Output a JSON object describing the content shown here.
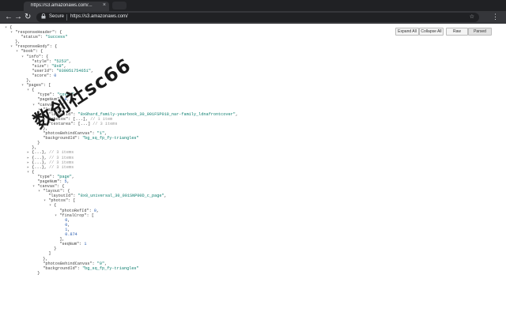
{
  "browser": {
    "tab_title": "https://s3.amazonaws.com/...",
    "tab_close": "×",
    "security_label": "Secure",
    "url": "https://s3.amazonaws.com/",
    "back": "←",
    "forward": "→",
    "reload": "↻",
    "star": "☆",
    "menu": "⋮",
    "lock": "🔒"
  },
  "viewer_toolbar": {
    "expand_all": "Expand All",
    "collapse_all": "Collapse All",
    "raw": "Raw",
    "parsed": "Parsed"
  },
  "json_lines": [
    {
      "i": 0,
      "t": "▾",
      "parts": [
        [
          "p",
          "{"
        ]
      ]
    },
    {
      "i": 1,
      "t": "▾",
      "parts": [
        [
          "k",
          "\"responseHeader\""
        ],
        [
          "p",
          ": {"
        ]
      ]
    },
    {
      "i": 2,
      "t": "",
      "parts": [
        [
          "k",
          "\"status\""
        ],
        [
          "p",
          ": "
        ],
        [
          "s",
          "\"Success\""
        ]
      ]
    },
    {
      "i": 1,
      "t": "",
      "parts": [
        [
          "p",
          "},"
        ]
      ]
    },
    {
      "i": 1,
      "t": "▾",
      "parts": [
        [
          "k",
          "\"responseBody\""
        ],
        [
          "p",
          ": {"
        ]
      ]
    },
    {
      "i": 2,
      "t": "▾",
      "parts": [
        [
          "k",
          "\"book\""
        ],
        [
          "p",
          ": {"
        ]
      ]
    },
    {
      "i": 3,
      "t": "▾",
      "parts": [
        [
          "k",
          "\"info\""
        ],
        [
          "p",
          ": {"
        ]
      ]
    },
    {
      "i": 4,
      "t": "",
      "parts": [
        [
          "k",
          "\"style\""
        ],
        [
          "p",
          ": "
        ],
        [
          "s",
          "\"5253\""
        ],
        [
          "p",
          ","
        ]
      ]
    },
    {
      "i": 4,
      "t": "",
      "parts": [
        [
          "k",
          "\"size\""
        ],
        [
          "p",
          ": "
        ],
        [
          "s",
          "\"8x8\""
        ],
        [
          "p",
          ","
        ]
      ]
    },
    {
      "i": 4,
      "t": "",
      "parts": [
        [
          "k",
          "\"userId\""
        ],
        [
          "p",
          ": "
        ],
        [
          "s",
          "\"039051754651\""
        ],
        [
          "p",
          ","
        ]
      ]
    },
    {
      "i": 4,
      "t": "",
      "parts": [
        [
          "k",
          "\"score\""
        ],
        [
          "p",
          ": "
        ],
        [
          "n",
          "0"
        ]
      ]
    },
    {
      "i": 3,
      "t": "",
      "parts": [
        [
          "p",
          "},"
        ]
      ]
    },
    {
      "i": 3,
      "t": "▾",
      "parts": [
        [
          "k",
          "\"pages\""
        ],
        [
          "p",
          ": ["
        ]
      ]
    },
    {
      "i": 4,
      "t": "▾",
      "parts": [
        [
          "p",
          "{"
        ]
      ]
    },
    {
      "i": 5,
      "t": "",
      "parts": [
        [
          "k",
          "\"type\""
        ],
        [
          "p",
          ": "
        ],
        [
          "s",
          "\"cover\""
        ],
        [
          "p",
          ","
        ]
      ]
    },
    {
      "i": 5,
      "t": "",
      "parts": [
        [
          "k",
          "\"pageNum\""
        ],
        [
          "p",
          ": "
        ],
        [
          "n",
          "0"
        ],
        [
          "p",
          ","
        ]
      ]
    },
    {
      "i": 5,
      "t": "▾",
      "parts": [
        [
          "k",
          "\"canvas\""
        ],
        [
          "p",
          ": {"
        ]
      ]
    },
    {
      "i": 6,
      "t": "▾",
      "parts": [
        [
          "k",
          "\"layout\""
        ],
        [
          "p",
          ": {"
        ]
      ]
    },
    {
      "i": 7,
      "t": "",
      "parts": [
        [
          "k",
          "\"layoutId\""
        ],
        [
          "p",
          ": "
        ],
        [
          "s",
          "\"8x8hard_family-yearbook_30_001FSP010_nar-family_ldnafrontcover\""
        ],
        [
          "p",
          ","
        ]
      ]
    },
    {
      "i": 7,
      "t": "▸",
      "parts": [
        [
          "k",
          "\"photos\""
        ],
        [
          "p",
          ": [...], "
        ],
        [
          "c",
          "// 1 item"
        ]
      ]
    },
    {
      "i": 7,
      "t": "▸",
      "parts": [
        [
          "k",
          "\"textarea\""
        ],
        [
          "p",
          ": [...] "
        ],
        [
          "c",
          "// 3 items"
        ]
      ]
    },
    {
      "i": 6,
      "t": "",
      "parts": [
        [
          "p",
          "},"
        ]
      ]
    },
    {
      "i": 6,
      "t": "",
      "parts": [
        [
          "k",
          "\"photosBehindCanvas\""
        ],
        [
          "p",
          ": "
        ],
        [
          "s",
          "\"1\""
        ],
        [
          "p",
          ","
        ]
      ]
    },
    {
      "i": 6,
      "t": "",
      "parts": [
        [
          "k",
          "\"backgroundId\""
        ],
        [
          "p",
          ": "
        ],
        [
          "s",
          "\"bg_sq_fp_fy-triangles\""
        ]
      ]
    },
    {
      "i": 5,
      "t": "",
      "parts": [
        [
          "p",
          "}"
        ]
      ]
    },
    {
      "i": 4,
      "t": "",
      "parts": [
        [
          "p",
          "},"
        ]
      ]
    },
    {
      "i": 4,
      "t": "▸",
      "parts": [
        [
          "p",
          "{...}, "
        ],
        [
          "c",
          "// 3 items"
        ]
      ]
    },
    {
      "i": 4,
      "t": "▸",
      "parts": [
        [
          "p",
          "{...}, "
        ],
        [
          "c",
          "// 3 items"
        ]
      ]
    },
    {
      "i": 4,
      "t": "▸",
      "parts": [
        [
          "p",
          "{...}, "
        ],
        [
          "c",
          "// 3 items"
        ]
      ]
    },
    {
      "i": 4,
      "t": "▸",
      "parts": [
        [
          "p",
          "{...}, "
        ],
        [
          "c",
          "// 3 items"
        ]
      ]
    },
    {
      "i": 4,
      "t": "▾",
      "parts": [
        [
          "p",
          "{"
        ]
      ]
    },
    {
      "i": 5,
      "t": "",
      "parts": [
        [
          "k",
          "\"type\""
        ],
        [
          "p",
          ": "
        ],
        [
          "s",
          "\"page\""
        ],
        [
          "p",
          ","
        ]
      ]
    },
    {
      "i": 5,
      "t": "",
      "parts": [
        [
          "k",
          "\"pageNum\""
        ],
        [
          "p",
          ": "
        ],
        [
          "n",
          "5"
        ],
        [
          "p",
          ","
        ]
      ]
    },
    {
      "i": 5,
      "t": "▾",
      "parts": [
        [
          "k",
          "\"canvas\""
        ],
        [
          "p",
          ": {"
        ]
      ]
    },
    {
      "i": 6,
      "t": "▾",
      "parts": [
        [
          "k",
          "\"layout\""
        ],
        [
          "p",
          ": {"
        ]
      ]
    },
    {
      "i": 7,
      "t": "",
      "parts": [
        [
          "k",
          "\"layoutId\""
        ],
        [
          "p",
          ": "
        ],
        [
          "s",
          "\"8x8_universal_30_001SNP00D_c_page\""
        ],
        [
          "p",
          ","
        ]
      ]
    },
    {
      "i": 7,
      "t": "▾",
      "parts": [
        [
          "k",
          "\"photos\""
        ],
        [
          "p",
          ": ["
        ]
      ]
    },
    {
      "i": 8,
      "t": "▾",
      "parts": [
        [
          "p",
          "{"
        ]
      ]
    },
    {
      "i": 9,
      "t": "",
      "parts": [
        [
          "k",
          "\"photoRefId\""
        ],
        [
          "p",
          ": "
        ],
        [
          "n",
          "0"
        ],
        [
          "p",
          ","
        ]
      ]
    },
    {
      "i": 9,
      "t": "▾",
      "parts": [
        [
          "k",
          "\"finalCrop\""
        ],
        [
          "p",
          ": ["
        ]
      ]
    },
    {
      "i": 10,
      "t": "",
      "parts": [
        [
          "n",
          "0"
        ],
        [
          "p",
          ","
        ]
      ]
    },
    {
      "i": 10,
      "t": "",
      "parts": [
        [
          "n",
          "0"
        ],
        [
          "p",
          ","
        ]
      ]
    },
    {
      "i": 10,
      "t": "",
      "parts": [
        [
          "n",
          "1"
        ],
        [
          "p",
          ","
        ]
      ]
    },
    {
      "i": 10,
      "t": "",
      "parts": [
        [
          "n",
          "0.874"
        ]
      ]
    },
    {
      "i": 9,
      "t": "",
      "parts": [
        [
          "p",
          "],"
        ]
      ]
    },
    {
      "i": 9,
      "t": "",
      "parts": [
        [
          "k",
          "\"seqNum\""
        ],
        [
          "p",
          ": "
        ],
        [
          "n",
          "1"
        ]
      ]
    },
    {
      "i": 8,
      "t": "",
      "parts": [
        [
          "p",
          "}"
        ]
      ]
    },
    {
      "i": 7,
      "t": "",
      "parts": [
        [
          "p",
          "]"
        ]
      ]
    },
    {
      "i": 6,
      "t": "",
      "parts": [
        [
          "p",
          "},"
        ]
      ]
    },
    {
      "i": 6,
      "t": "",
      "parts": [
        [
          "k",
          "\"photosBehindCanvas\""
        ],
        [
          "p",
          ": "
        ],
        [
          "s",
          "\"0\""
        ],
        [
          "p",
          ","
        ]
      ]
    },
    {
      "i": 6,
      "t": "",
      "parts": [
        [
          "k",
          "\"backgroundId\""
        ],
        [
          "p",
          ": "
        ],
        [
          "s",
          "\"bg_sq_fp_fy-triangles\""
        ]
      ]
    },
    {
      "i": 5,
      "t": "",
      "parts": [
        [
          "p",
          "}"
        ]
      ]
    }
  ],
  "watermark": "数创社sc66",
  "colors": {
    "key": "#444444",
    "string": "#0b7d6e",
    "number": "#2a5db0",
    "comment": "#999999"
  }
}
